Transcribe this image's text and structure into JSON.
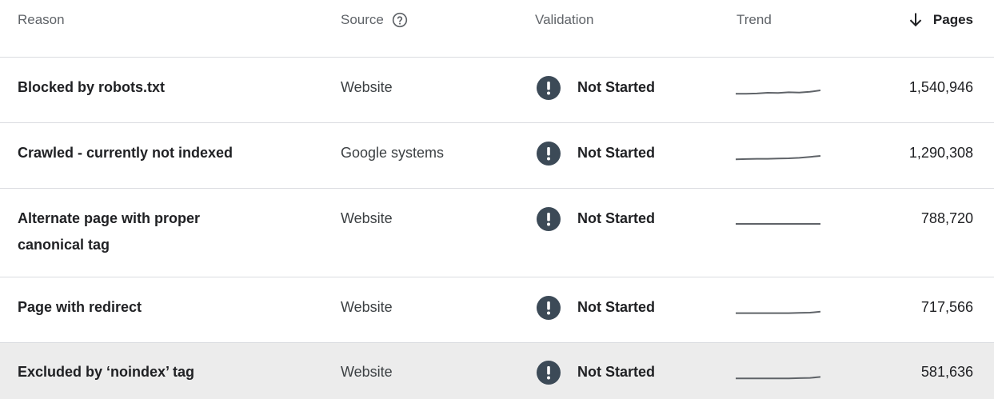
{
  "header": {
    "reason": "Reason",
    "source": "Source",
    "validation": "Validation",
    "trend": "Trend",
    "pages": "Pages",
    "source_help_icon": "help-circle-icon",
    "pages_sort_icon": "arrow-down-icon"
  },
  "rows": [
    {
      "reason_line1": "Blocked by robots.txt",
      "reason_line2": "",
      "source": "Website",
      "validation": "Not Started",
      "validation_icon": "exclamation-circle-icon",
      "pages": "1,540,946",
      "trend": [
        0.3,
        0.3,
        0.35,
        0.5,
        0.45,
        0.6,
        0.55,
        0.7,
        1.0
      ]
    },
    {
      "reason_line1": "Crawled - currently not indexed",
      "reason_line2": "",
      "source": "Google systems",
      "validation": "Not Started",
      "validation_icon": "exclamation-circle-icon",
      "pages": "1,290,308",
      "trend": [
        0.3,
        0.35,
        0.4,
        0.4,
        0.45,
        0.5,
        0.6,
        0.8,
        1.0
      ]
    },
    {
      "reason_line1": "Alternate page with proper",
      "reason_line2": "canonical tag",
      "source": "Website",
      "validation": "Not Started",
      "validation_icon": "exclamation-circle-icon",
      "pages": "788,720",
      "trend": [
        0.5,
        0.5,
        0.5,
        0.5,
        0.5,
        0.5,
        0.5,
        0.5,
        0.5
      ]
    },
    {
      "reason_line1": "Page with redirect",
      "reason_line2": "",
      "source": "Website",
      "validation": "Not Started",
      "validation_icon": "exclamation-circle-icon",
      "pages": "717,566",
      "trend": [
        0.4,
        0.4,
        0.4,
        0.4,
        0.4,
        0.4,
        0.45,
        0.5,
        0.7
      ]
    },
    {
      "reason_line1": "Excluded by ‘noindex’ tag",
      "reason_line2": "",
      "source": "Website",
      "validation": "Not Started",
      "validation_icon": "exclamation-circle-icon",
      "pages": "581,636",
      "trend": [
        0.3,
        0.3,
        0.3,
        0.3,
        0.3,
        0.3,
        0.35,
        0.4,
        0.6
      ]
    }
  ]
}
